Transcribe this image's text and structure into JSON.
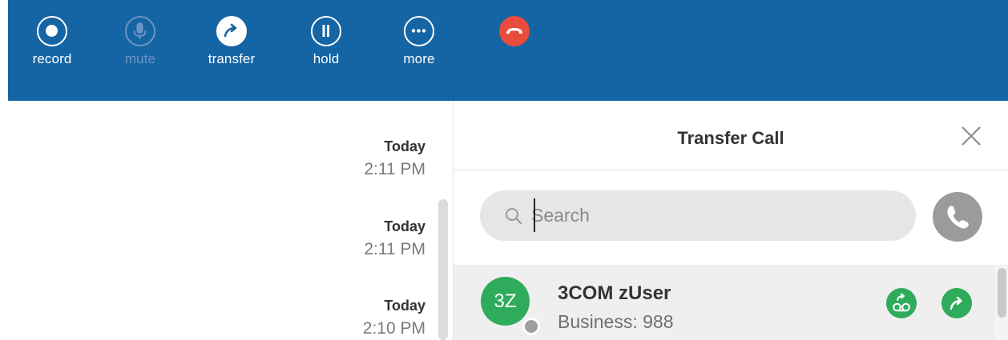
{
  "toolbar": {
    "record_label": "record",
    "mute_label": "mute",
    "transfer_label": "transfer",
    "hold_label": "hold",
    "more_label": "more",
    "background_color": "#1565a5",
    "end_call_color": "#e94b3c"
  },
  "history": [
    {
      "day": "Today",
      "time": "2:11 PM"
    },
    {
      "day": "Today",
      "time": "2:11 PM"
    },
    {
      "day": "Today",
      "time": "2:10 PM"
    }
  ],
  "transfer_panel": {
    "title": "Transfer Call",
    "search": {
      "value": "",
      "placeholder": "Search"
    },
    "contacts": [
      {
        "initials": "3Z",
        "name": "3COM zUser",
        "detail": "Business: 988",
        "avatar_color": "#2eab5b",
        "presence": "offline"
      }
    ]
  }
}
